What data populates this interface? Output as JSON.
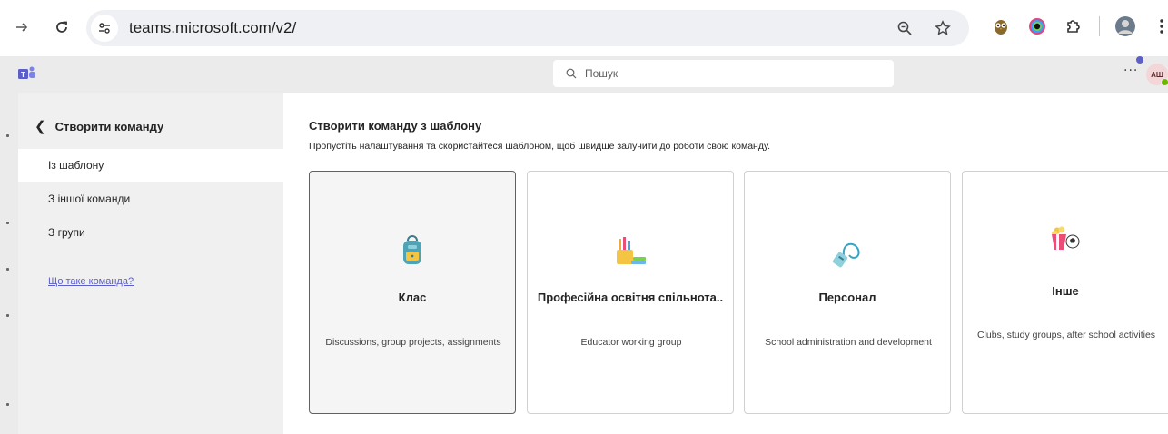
{
  "browser": {
    "url": "teams.microsoft.com/v2/"
  },
  "teams_bar": {
    "search_placeholder": "Пошук",
    "more": "···",
    "avatar_initials": "АШ"
  },
  "left_panel": {
    "title": "Створити команду",
    "items": [
      {
        "label": "Із шаблону",
        "active": true
      },
      {
        "label": "З іншої команди",
        "active": false
      },
      {
        "label": "З групи",
        "active": false
      }
    ],
    "help_link": "Що таке команда?"
  },
  "main": {
    "title": "Створити команду з шаблону",
    "subtitle": "Пропустіть налаштування та скористайтеся шаблоном, щоб швидше залучити до роботи свою команду.",
    "cards": [
      {
        "title": "Клас",
        "description": "Discussions, group projects, assignments",
        "icon": "backpack-icon",
        "selected": true
      },
      {
        "title": "Професійна освітня спільнота..",
        "description": "Educator working group",
        "icon": "pencil-cup-books-icon",
        "selected": false
      },
      {
        "title": "Персонал",
        "description": "School administration and development",
        "icon": "lanyard-badge-icon",
        "selected": false
      },
      {
        "title": "Інше",
        "description": "Clubs, study groups, after school activities",
        "icon": "popcorn-soccer-icon",
        "selected": false
      }
    ]
  }
}
